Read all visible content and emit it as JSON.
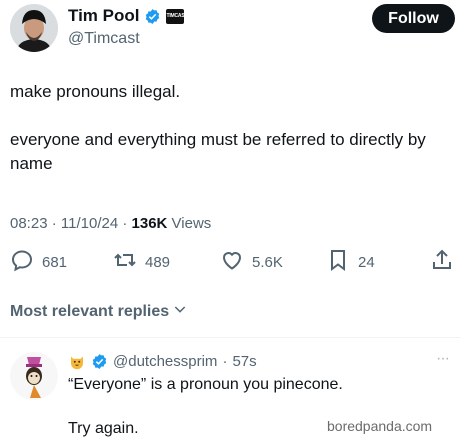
{
  "author": {
    "name": "Tim Pool",
    "handle": "@Timcast",
    "org_badge": "TIMCAST"
  },
  "header": {
    "follow_label": "Follow"
  },
  "tweet": {
    "line1": "make pronouns illegal.",
    "line2": "everyone and everything must be referred to directly by name"
  },
  "meta": {
    "time": "08:23",
    "date": "11/10/24",
    "views_count": "136K",
    "views_label": "Views"
  },
  "actions": {
    "replies": "681",
    "reposts": "489",
    "likes": "5.6K",
    "bookmarks": "24"
  },
  "replies_sort": {
    "label": "Most relevant replies"
  },
  "reply": {
    "handle": "@dutchessprim",
    "age": "57s",
    "line1": "“Everyone” is a pronoun you pinecone.",
    "line2": "Try again."
  },
  "watermark": "boredpanda.com",
  "colors": {
    "verified_blue": "#1d9bf0",
    "text_primary": "#0f1419",
    "text_secondary": "#536471"
  }
}
